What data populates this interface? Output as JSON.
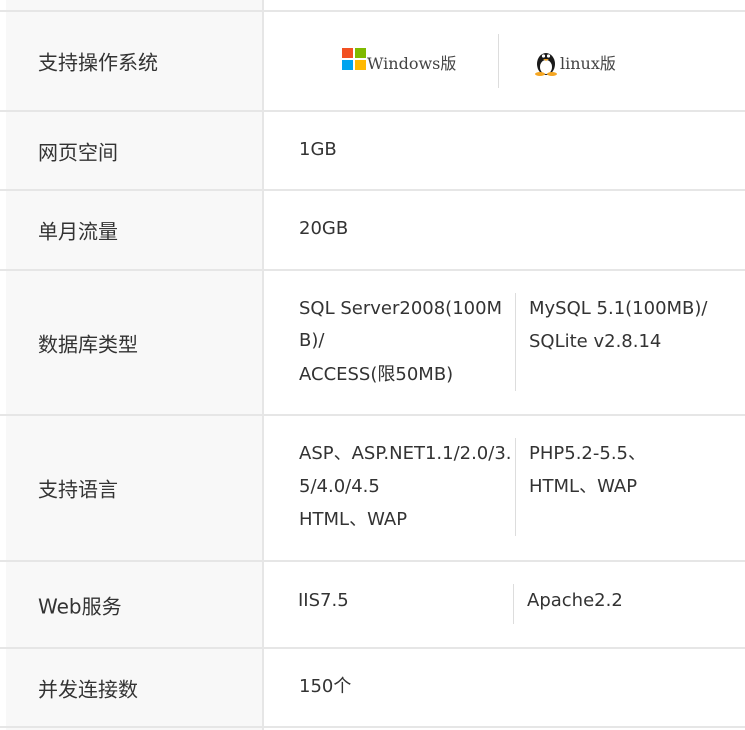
{
  "rows": {
    "os": {
      "label": "支持操作系统",
      "windows": "Windows版",
      "linux": "linux版",
      "windows_icon": "windows-logo",
      "linux_icon": "tux-penguin",
      "windows_colors": [
        "#f25022",
        "#7fba00",
        "#00a4ef",
        "#ffb900"
      ]
    },
    "space": {
      "label": "网页空间",
      "value": "1GB"
    },
    "traffic": {
      "label": "单月流量",
      "value": "20GB"
    },
    "database": {
      "label": "数据库类型",
      "windows_lines": [
        "SQL Server2008(100M",
        "B)/",
        "ACCESS(限50MB)"
      ],
      "linux_lines": [
        "MySQL 5.1(100MB)/",
        "SQLite v2.8.14"
      ]
    },
    "language": {
      "label": "支持语言",
      "windows_lines": [
        "ASP、ASP.NET1.1/2.0/3.",
        "5/4.0/4.5",
        "HTML、WAP"
      ],
      "linux_lines": [
        "PHP5.2-5.5、",
        "HTML、WAP"
      ]
    },
    "web": {
      "label": "Web服务",
      "windows": "IIS7.5",
      "linux": "Apache2.2"
    },
    "connections": {
      "label": "并发连接数",
      "value": "150个"
    }
  }
}
